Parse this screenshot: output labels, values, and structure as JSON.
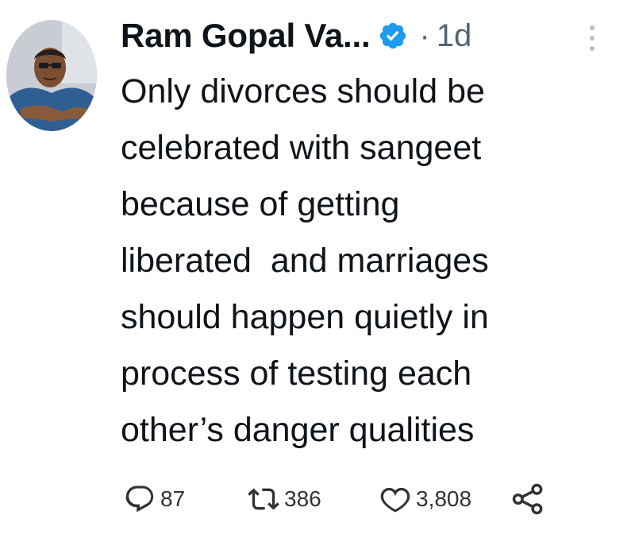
{
  "author": {
    "name": "Ram Gopal Va...",
    "verified": true
  },
  "meta": {
    "separator": "·",
    "time": "1d"
  },
  "tweet": {
    "lines": [
      "Only divorces should be",
      "celebrated with sangeet",
      "because of getting",
      "liberated  and marriages",
      "should happen quietly in",
      "process of testing each",
      "other’s danger qualities"
    ]
  },
  "actions": {
    "replies": "87",
    "retweets": "386",
    "likes": "3,808"
  },
  "icons": {
    "reply": "reply-icon",
    "retweet": "retweet-icon",
    "like": "heart-icon",
    "share": "share-icon",
    "verified": "verified-badge-icon",
    "more": "more-options-icon"
  },
  "colors": {
    "verified": "#1d9bf0",
    "text": "#0f1419",
    "secondary": "#536471"
  }
}
